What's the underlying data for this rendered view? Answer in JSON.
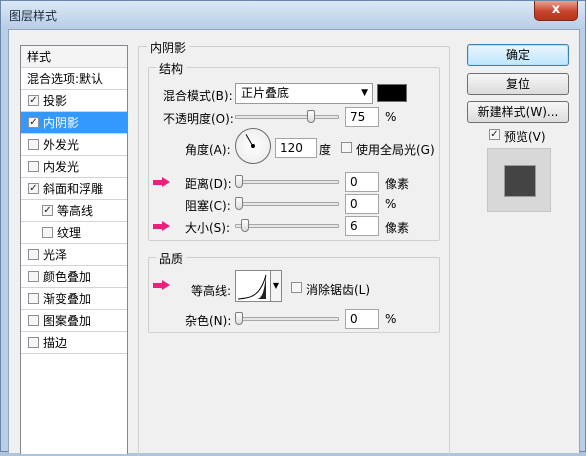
{
  "window": {
    "title": "图层样式",
    "close_glyph": "x"
  },
  "style_list": {
    "header": "样式",
    "blend_options": "混合选项:默认",
    "items": [
      {
        "label": "投影",
        "checked": true
      },
      {
        "label": "内阴影",
        "checked": true,
        "selected": true
      },
      {
        "label": "外发光",
        "checked": false
      },
      {
        "label": "内发光",
        "checked": false
      },
      {
        "label": "斜面和浮雕",
        "checked": true
      },
      {
        "label": "等高线",
        "checked": true,
        "sub": true
      },
      {
        "label": "纹理",
        "checked": false,
        "sub": true
      },
      {
        "label": "光泽",
        "checked": false
      },
      {
        "label": "颜色叠加",
        "checked": false
      },
      {
        "label": "渐变叠加",
        "checked": false
      },
      {
        "label": "图案叠加",
        "checked": false
      },
      {
        "label": "描边",
        "checked": false
      }
    ]
  },
  "panel": {
    "section_title": "内阴影",
    "structure": {
      "title": "结构",
      "blend_mode_label": "混合模式(B):",
      "blend_mode_value": "正片叠底",
      "opacity_label": "不透明度(O):",
      "opacity_value": "75",
      "opacity_unit": "%",
      "opacity_fraction": 0.75,
      "angle_label": "角度(A):",
      "angle_value": "120",
      "angle_unit": "度",
      "global_light_label": "使用全局光(G)",
      "global_light_checked": false,
      "distance_label": "距离(D):",
      "distance_value": "0",
      "distance_unit": "像素",
      "choke_label": "阻塞(C):",
      "choke_value": "0",
      "choke_unit": "%",
      "size_label": "大小(S):",
      "size_value": "6",
      "size_unit": "像素"
    },
    "quality": {
      "title": "品质",
      "contour_label": "等高线:",
      "antialias_label": "消除锯齿(L)",
      "antialias_checked": false,
      "noise_label": "杂色(N):",
      "noise_value": "0",
      "noise_unit": "%"
    }
  },
  "buttons": {
    "ok": "确定",
    "reset": "复位",
    "new_style": "新建样式(W)...",
    "preview_label": "预览(V)",
    "preview_checked": true
  },
  "colors": {
    "selected": "#3399ff",
    "shadow_color": "#000000",
    "highlight_arrow": "#ec1f7c",
    "preview_fill": "#444444"
  }
}
